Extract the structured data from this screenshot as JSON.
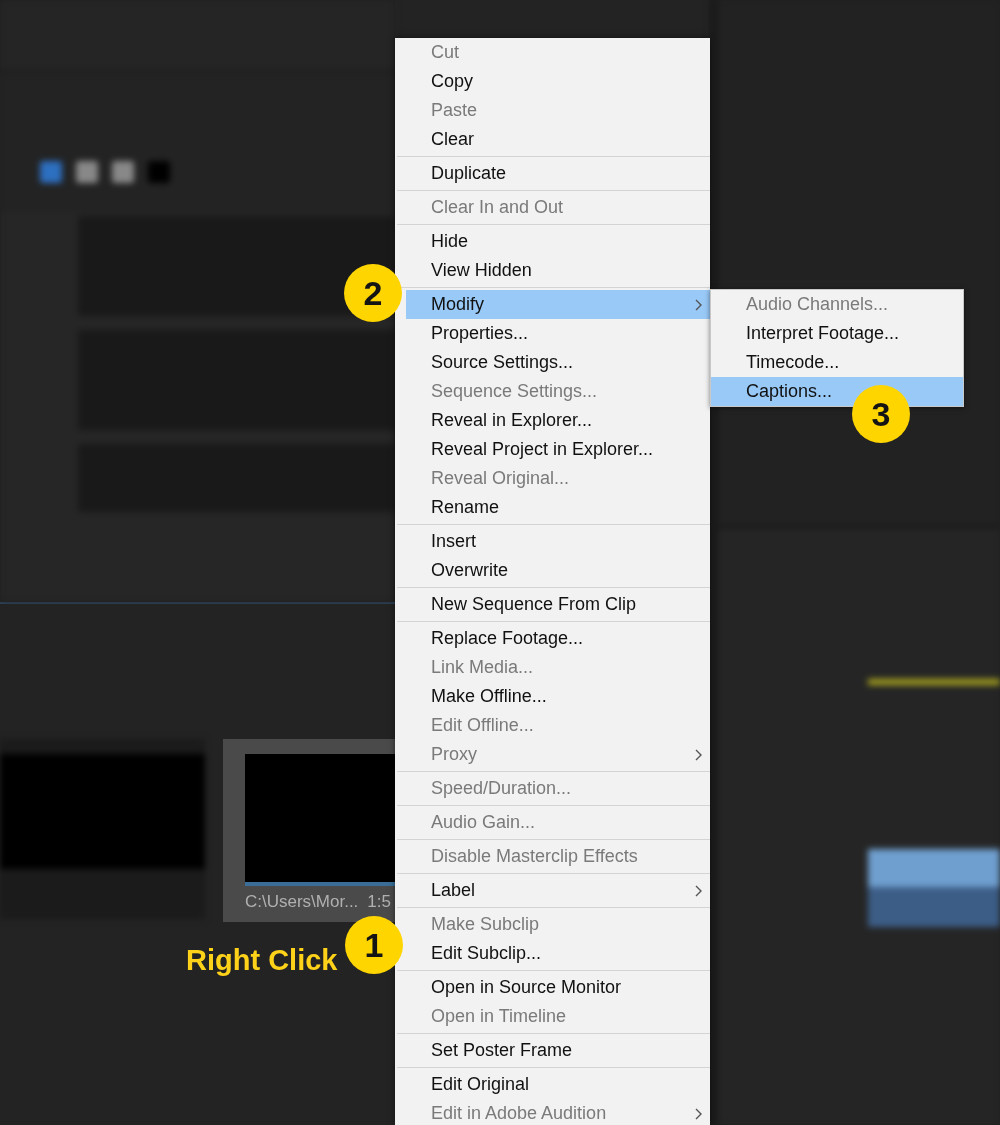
{
  "thumbnail": {
    "path": "C:\\Users\\Mor...",
    "duration": "1:5"
  },
  "menu": {
    "groups": [
      [
        {
          "label": "Cut",
          "disabled": true,
          "selected": false,
          "submenu": false
        },
        {
          "label": "Copy",
          "disabled": false,
          "selected": false,
          "submenu": false
        },
        {
          "label": "Paste",
          "disabled": true,
          "selected": false,
          "submenu": false
        },
        {
          "label": "Clear",
          "disabled": false,
          "selected": false,
          "submenu": false
        }
      ],
      [
        {
          "label": "Duplicate",
          "disabled": false,
          "selected": false,
          "submenu": false
        }
      ],
      [
        {
          "label": "Clear In and Out",
          "disabled": true,
          "selected": false,
          "submenu": false
        }
      ],
      [
        {
          "label": "Hide",
          "disabled": false,
          "selected": false,
          "submenu": false
        },
        {
          "label": "View Hidden",
          "disabled": false,
          "selected": false,
          "submenu": false
        }
      ],
      [
        {
          "label": "Modify",
          "disabled": false,
          "selected": true,
          "submenu": true
        },
        {
          "label": "Properties...",
          "disabled": false,
          "selected": false,
          "submenu": false
        },
        {
          "label": "Source Settings...",
          "disabled": false,
          "selected": false,
          "submenu": false
        },
        {
          "label": "Sequence Settings...",
          "disabled": true,
          "selected": false,
          "submenu": false
        },
        {
          "label": "Reveal in Explorer...",
          "disabled": false,
          "selected": false,
          "submenu": false
        },
        {
          "label": "Reveal Project in Explorer...",
          "disabled": false,
          "selected": false,
          "submenu": false
        },
        {
          "label": "Reveal Original...",
          "disabled": true,
          "selected": false,
          "submenu": false
        },
        {
          "label": "Rename",
          "disabled": false,
          "selected": false,
          "submenu": false
        }
      ],
      [
        {
          "label": "Insert",
          "disabled": false,
          "selected": false,
          "submenu": false
        },
        {
          "label": "Overwrite",
          "disabled": false,
          "selected": false,
          "submenu": false
        }
      ],
      [
        {
          "label": "New Sequence From Clip",
          "disabled": false,
          "selected": false,
          "submenu": false
        }
      ],
      [
        {
          "label": "Replace Footage...",
          "disabled": false,
          "selected": false,
          "submenu": false
        },
        {
          "label": "Link Media...",
          "disabled": true,
          "selected": false,
          "submenu": false
        },
        {
          "label": "Make Offline...",
          "disabled": false,
          "selected": false,
          "submenu": false
        },
        {
          "label": "Edit Offline...",
          "disabled": true,
          "selected": false,
          "submenu": false
        },
        {
          "label": "Proxy",
          "disabled": true,
          "selected": false,
          "submenu": true
        }
      ],
      [
        {
          "label": "Speed/Duration...",
          "disabled": true,
          "selected": false,
          "submenu": false
        }
      ],
      [
        {
          "label": "Audio Gain...",
          "disabled": true,
          "selected": false,
          "submenu": false
        }
      ],
      [
        {
          "label": "Disable Masterclip Effects",
          "disabled": true,
          "selected": false,
          "submenu": false
        }
      ],
      [
        {
          "label": "Label",
          "disabled": false,
          "selected": false,
          "submenu": true
        }
      ],
      [
        {
          "label": "Make Subclip",
          "disabled": true,
          "selected": false,
          "submenu": false
        },
        {
          "label": "Edit Subclip...",
          "disabled": false,
          "selected": false,
          "submenu": false
        }
      ],
      [
        {
          "label": "Open in Source Monitor",
          "disabled": false,
          "selected": false,
          "submenu": false
        },
        {
          "label": "Open in Timeline",
          "disabled": true,
          "selected": false,
          "submenu": false
        }
      ],
      [
        {
          "label": "Set Poster Frame",
          "disabled": false,
          "selected": false,
          "submenu": false
        }
      ],
      [
        {
          "label": "Edit Original",
          "disabled": false,
          "selected": false,
          "submenu": false
        },
        {
          "label": "Edit in Adobe Audition",
          "disabled": true,
          "selected": false,
          "submenu": true
        }
      ]
    ]
  },
  "submenu": {
    "items": [
      {
        "label": "Audio Channels...",
        "disabled": true,
        "selected": false
      },
      {
        "label": "Interpret Footage...",
        "disabled": false,
        "selected": false
      },
      {
        "label": "Timecode...",
        "disabled": false,
        "selected": false
      },
      {
        "label": "Captions...",
        "disabled": false,
        "selected": true
      }
    ]
  },
  "steps": [
    {
      "number": "1"
    },
    {
      "number": "2"
    },
    {
      "number": "3"
    }
  ],
  "annotation": "Right Click"
}
